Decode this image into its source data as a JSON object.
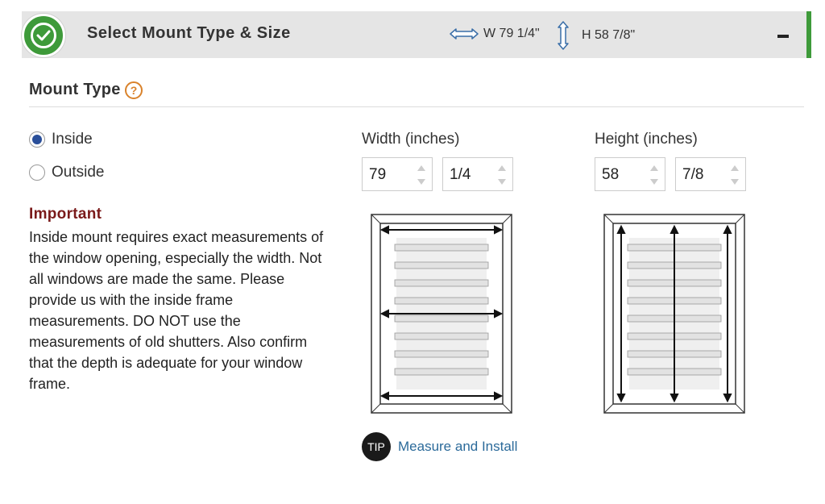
{
  "header": {
    "title": "Select Mount Type & Size",
    "width_display": "W 79 1/4\"",
    "height_display": "H 58 7/8\""
  },
  "mount_type": {
    "title": "Mount Type",
    "help": "?",
    "options": [
      {
        "label": "Inside",
        "selected": true
      },
      {
        "label": "Outside",
        "selected": false
      }
    ]
  },
  "important": {
    "title": "Important",
    "text": "Inside mount requires exact measurements of the window opening, especially the width. Not all windows are made the same. Please provide us with the inside frame measurements. DO NOT use the measurements of old shutters. Also confirm that the depth is adequate for your window frame."
  },
  "width": {
    "label": "Width (inches)",
    "whole": "79",
    "fraction": "1/4"
  },
  "height": {
    "label": "Height (inches)",
    "whole": "58",
    "fraction": "7/8"
  },
  "tip": {
    "badge": "TIP",
    "link": "Measure and Install"
  },
  "colors": {
    "accent_green": "#3e9a3a",
    "important_red": "#7a1a1a",
    "link_blue": "#2b6a9a",
    "help_orange": "#d9822b",
    "radio_blue": "#2a4f9a"
  }
}
